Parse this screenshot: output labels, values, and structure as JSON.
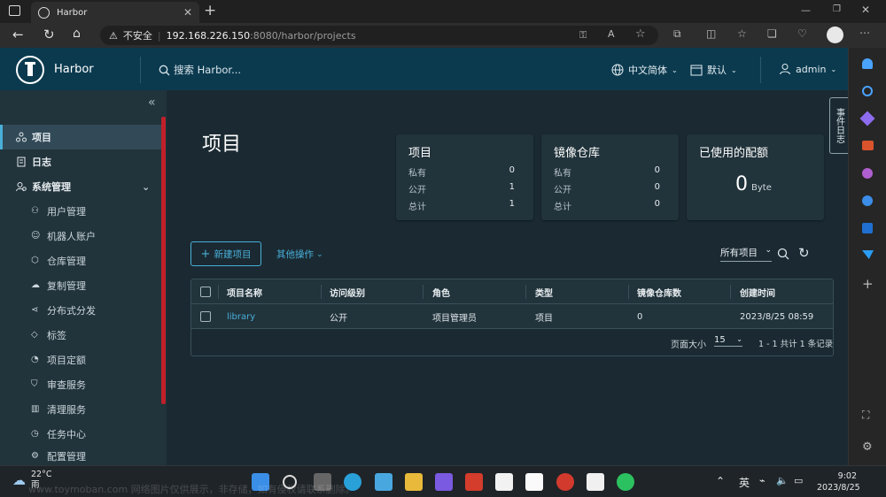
{
  "browser": {
    "tab_title": "Harbor",
    "security_label": "不安全",
    "url_host": "192.168.226.150",
    "url_path": ":8080/harbor/projects"
  },
  "header": {
    "app_name": "Harbor",
    "search_placeholder": "搜索 Harbor...",
    "language": "中文简体",
    "datetime_format": "默认",
    "user": "admin"
  },
  "nav": {
    "items": [
      {
        "label": "项目",
        "icon": "projects-icon"
      },
      {
        "label": "日志",
        "icon": "logs-icon"
      },
      {
        "label": "系统管理",
        "icon": "admin-icon"
      }
    ],
    "sub_items": [
      {
        "label": "用户管理",
        "icon": "users-icon"
      },
      {
        "label": "机器人账户",
        "icon": "robot-icon"
      },
      {
        "label": "仓库管理",
        "icon": "registry-icon"
      },
      {
        "label": "复制管理",
        "icon": "replication-icon"
      },
      {
        "label": "分布式分发",
        "icon": "distribution-icon"
      },
      {
        "label": "标签",
        "icon": "tag-icon"
      },
      {
        "label": "项目定额",
        "icon": "quota-icon"
      },
      {
        "label": "审查服务",
        "icon": "shield-icon"
      },
      {
        "label": "清理服务",
        "icon": "trash-icon"
      },
      {
        "label": "任务中心",
        "icon": "task-icon"
      },
      {
        "label": "配置管理",
        "icon": "gear-icon"
      }
    ]
  },
  "main": {
    "title": "项目",
    "cards": {
      "projects": {
        "title": "项目",
        "private_label": "私有",
        "private": "0",
        "public_label": "公开",
        "public": "1",
        "total_label": "总计",
        "total": "1"
      },
      "repos": {
        "title": "镜像仓库",
        "private_label": "私有",
        "private": "0",
        "public_label": "公开",
        "public": "0",
        "total_label": "总计",
        "total": "0"
      },
      "quota": {
        "title": "已使用的配额",
        "value": "0",
        "unit": "Byte"
      }
    },
    "new_project_label": "新建项目",
    "other_actions_label": "其他操作",
    "filter_label": "所有项目",
    "event_tab_label": "事件日志"
  },
  "table": {
    "columns": [
      "项目名称",
      "访问级别",
      "角色",
      "类型",
      "镜像仓库数",
      "创建时间"
    ],
    "rows": [
      {
        "name": "library",
        "access": "公开",
        "role": "项目管理员",
        "type": "项目",
        "repo_count": "0",
        "created": "2023/8/25 08:59"
      }
    ],
    "page_size_label": "页面大小",
    "page_size": "15",
    "summary": "1 - 1 共计 1 条记录"
  },
  "taskbar": {
    "temperature": "22°C",
    "weather": "雨",
    "ime": "英",
    "time": "9:02",
    "date": "2023/8/25",
    "watermark": "www.toymoban.com 网络图片仅供展示，非存储，如有侵权请联系删除。"
  },
  "colors": {
    "header_bg": "#0b3a4f",
    "nav_bg": "#21333b",
    "main_bg": "#1b2a32",
    "accent": "#49afd9"
  }
}
